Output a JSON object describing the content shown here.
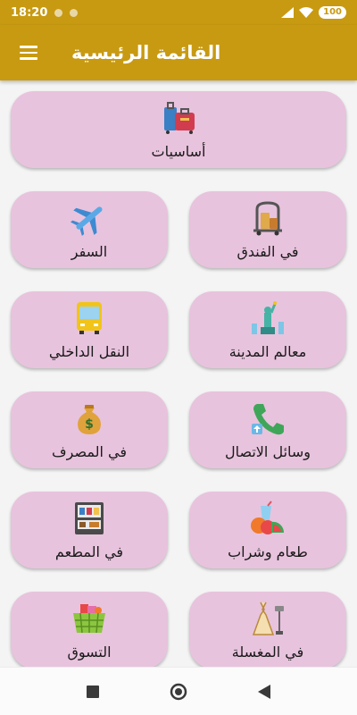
{
  "status_bar": {
    "time": "18:20",
    "battery": "100"
  },
  "app_bar": {
    "title": "القائمة الرئيسية"
  },
  "cards": {
    "basics": "أساسيات",
    "travel": "السفر",
    "hotel": "في الفندق",
    "local_transport": "النقل الداخلي",
    "city_landmarks": "معالم المدينة",
    "bank": "في المصرف",
    "communication": "وسائل الاتصال",
    "restaurant": "في المطعم",
    "food_drink": "طعام وشراب",
    "shopping": "التسوق",
    "laundry": "في المغسلة"
  },
  "icons": {
    "basics": "luggage-icon",
    "travel": "airplane-icon",
    "hotel": "luggage-cart-icon",
    "local_transport": "bus-icon",
    "city_landmarks": "statue-of-liberty-icon",
    "bank": "money-bag-icon",
    "communication": "phone-icon",
    "restaurant": "vending-machine-icon",
    "food_drink": "fruit-drink-icon",
    "shopping": "shopping-basket-icon",
    "laundry": "dress-hanger-icon"
  },
  "colors": {
    "primary": "#c89a12",
    "card_background": "#e8c3dd",
    "page_background": "#f4f4f4"
  }
}
